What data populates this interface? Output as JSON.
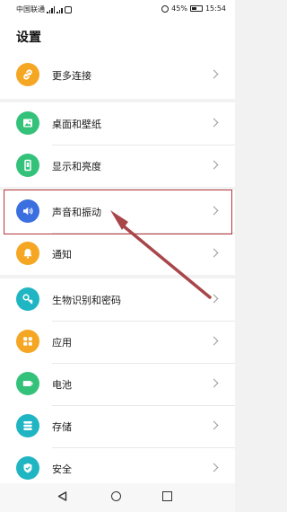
{
  "status_bar": {
    "carrier": "中国联通",
    "battery": "45%",
    "time": "15:54"
  },
  "header": {
    "title": "设置"
  },
  "groups": [
    {
      "items": [
        {
          "label": "更多连接",
          "icon": "link-icon",
          "color": "#f5a623"
        }
      ]
    },
    {
      "items": [
        {
          "label": "桌面和壁纸",
          "icon": "image-icon",
          "color": "#34c27a"
        },
        {
          "label": "显示和亮度",
          "icon": "phone-icon",
          "color": "#34c27a"
        }
      ]
    },
    {
      "items": [
        {
          "label": "声音和振动",
          "icon": "speaker-icon",
          "color": "#3b6fe0"
        },
        {
          "label": "通知",
          "icon": "bell-icon",
          "color": "#f5a623"
        }
      ]
    },
    {
      "items": [
        {
          "label": "生物识别和密码",
          "icon": "key-icon",
          "color": "#1fb5c2"
        },
        {
          "label": "应用",
          "icon": "apps-icon",
          "color": "#f5a623"
        },
        {
          "label": "电池",
          "icon": "battery-icon",
          "color": "#34c27a"
        },
        {
          "label": "存储",
          "icon": "storage-icon",
          "color": "#1fb5c2"
        },
        {
          "label": "安全",
          "icon": "shield-icon",
          "color": "#1fb5c2"
        }
      ]
    }
  ],
  "colors": {
    "highlight": "#b7363b",
    "arrow": "#a8464a"
  }
}
